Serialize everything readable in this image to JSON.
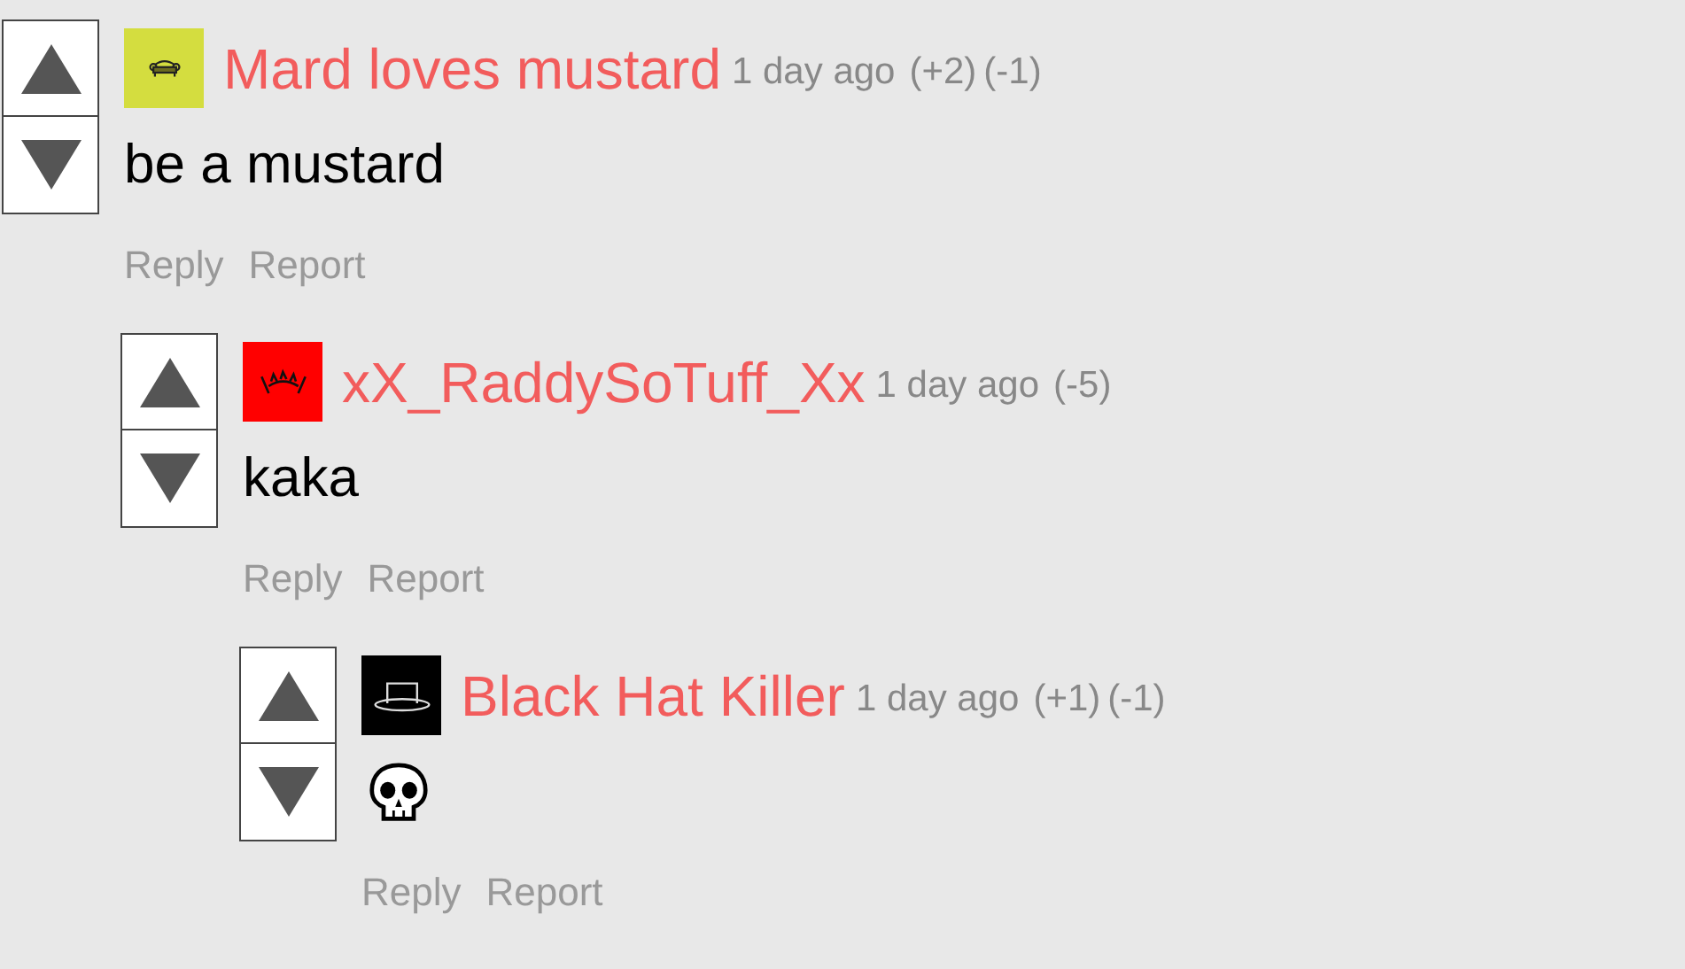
{
  "comments": [
    {
      "author": "Mard loves mustard",
      "avatar": {
        "kind": "couch",
        "color": "#d4dd3f"
      },
      "time": "1 day ago",
      "votes": [
        "(+2)",
        "(-1)"
      ],
      "body": {
        "kind": "text",
        "text": "be a mustard"
      },
      "actions": [
        "Reply",
        "Report"
      ],
      "children": [
        {
          "author": "xX_RaddySoTuff_Xx",
          "avatar": {
            "kind": "crown",
            "color": "#ff0000"
          },
          "time": "1 day ago",
          "votes": [
            "(-5)"
          ],
          "body": {
            "kind": "text",
            "text": "kaka"
          },
          "actions": [
            "Reply",
            "Report"
          ],
          "children": [
            {
              "author": "Black Hat Killer",
              "avatar": {
                "kind": "hat",
                "color": "#000000"
              },
              "time": "1 day ago",
              "votes": [
                "(+1)",
                "(-1)"
              ],
              "body": {
                "kind": "skull"
              },
              "actions": [
                "Reply",
                "Report"
              ]
            }
          ]
        }
      ]
    }
  ]
}
